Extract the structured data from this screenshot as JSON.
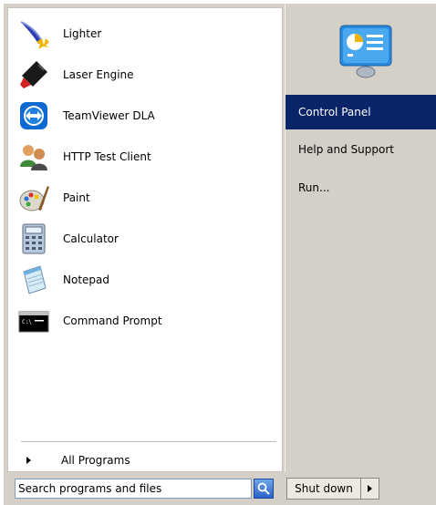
{
  "programs": [
    {
      "label": "Lighter",
      "icon": "lighter-icon"
    },
    {
      "label": "Laser Engine",
      "icon": "laser-engine-icon"
    },
    {
      "label": "TeamViewer DLA",
      "icon": "teamviewer-icon"
    },
    {
      "label": "HTTP Test Client",
      "icon": "http-test-client-icon"
    },
    {
      "label": "Paint",
      "icon": "paint-icon"
    },
    {
      "label": "Calculator",
      "icon": "calculator-icon"
    },
    {
      "label": "Notepad",
      "icon": "notepad-icon"
    },
    {
      "label": "Command Prompt",
      "icon": "command-prompt-icon"
    }
  ],
  "all_programs": {
    "label": "All Programs"
  },
  "right_pane": {
    "icon": "control-panel-icon",
    "items": [
      {
        "label": "Control Panel",
        "selected": true
      },
      {
        "label": "Help and Support",
        "selected": false
      },
      {
        "label": "Run...",
        "selected": false
      }
    ]
  },
  "search": {
    "placeholder": "Search programs and files"
  },
  "shutdown": {
    "label": "Shut down"
  },
  "colors": {
    "selection": "#0a246a",
    "background": "#d4d0c8",
    "pane": "#ffffff"
  }
}
